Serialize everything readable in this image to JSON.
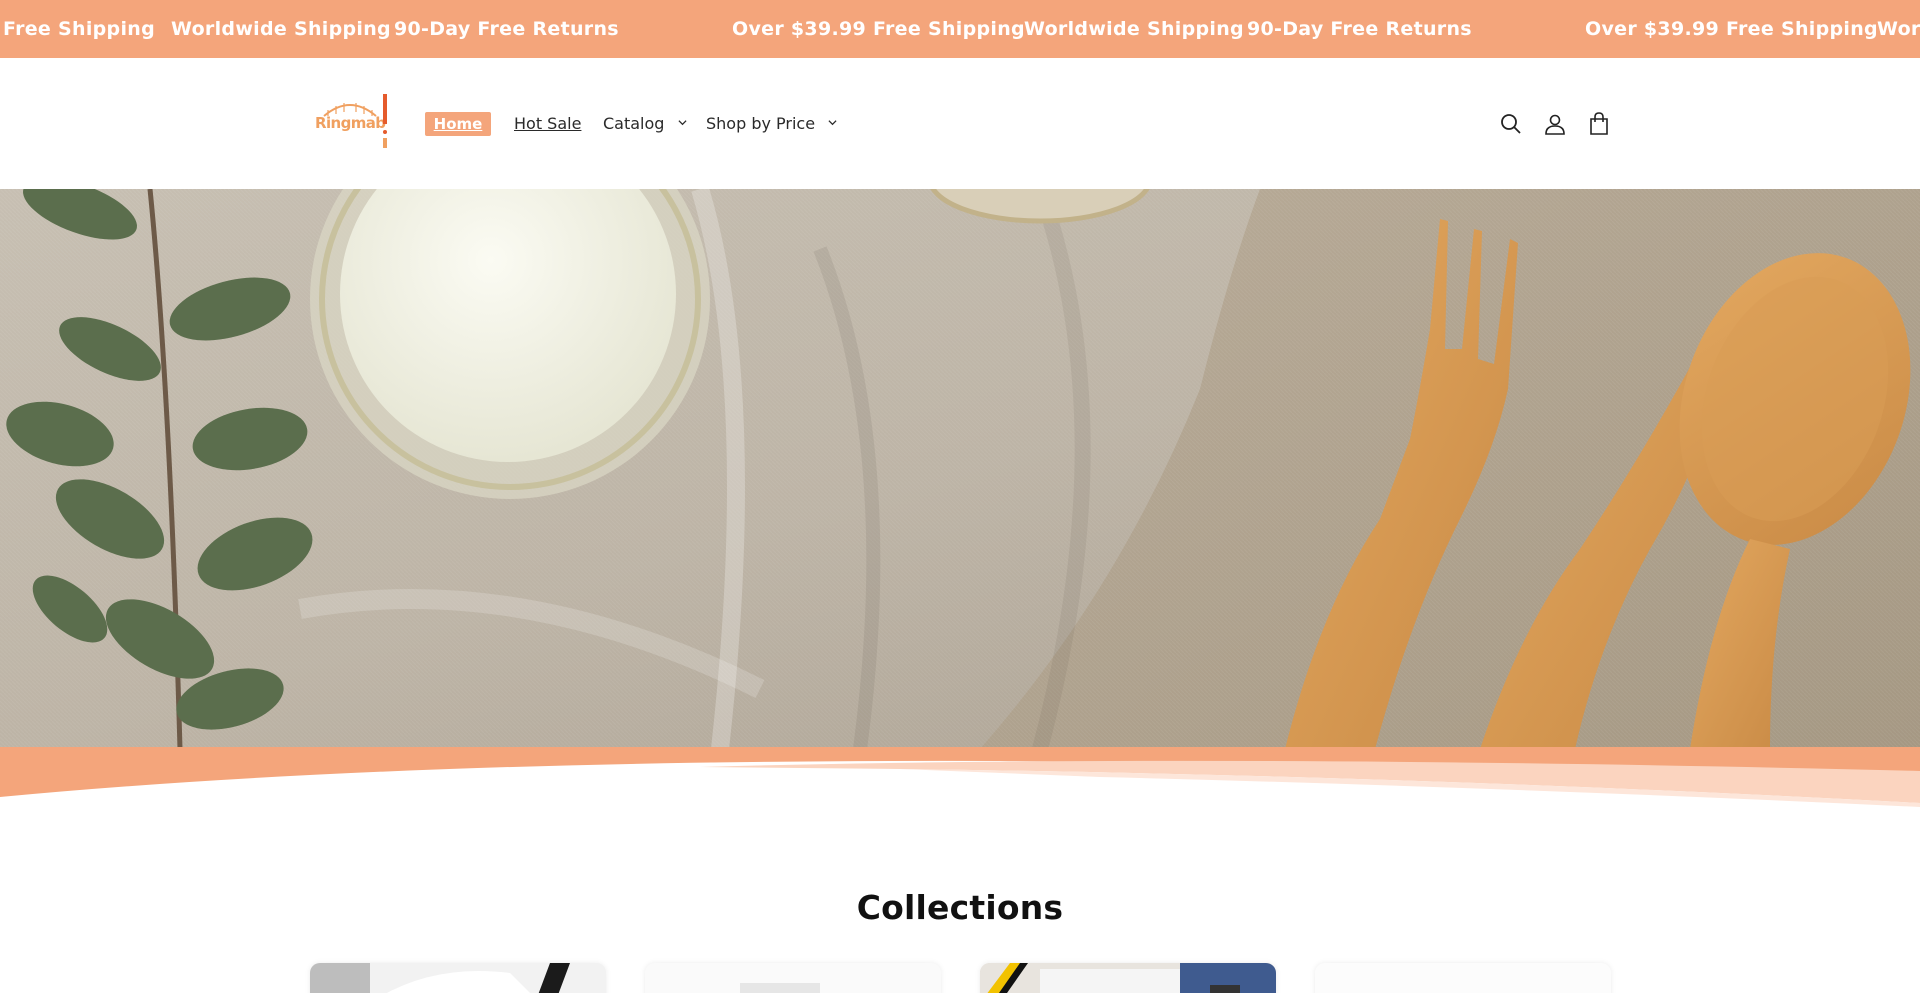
{
  "announcement": {
    "items": [
      "Free Shipping",
      "Worldwide Shipping",
      "90-Day Free Returns",
      "Over $39.99 Free Shipping",
      "Worldwide Shipping",
      "90-Day Free Returns",
      "Over $39.99 Free Shipping",
      "Wor"
    ],
    "background": "#f4a57b",
    "text_color": "#ffffff"
  },
  "header": {
    "logo_text": "Ringmab",
    "nav": {
      "home": "Home",
      "hot_sale": "Hot Sale",
      "catalog": "Catalog",
      "shop_by_price": "Shop by Price"
    },
    "icons": [
      "search-icon",
      "account-icon",
      "cart-icon"
    ],
    "accent": "#f4a57b"
  },
  "hero": {
    "image_label": "Wooden fork, knife and spoon on linen with yogurt bowl and eucalyptus"
  },
  "collections": {
    "title": "Collections"
  }
}
